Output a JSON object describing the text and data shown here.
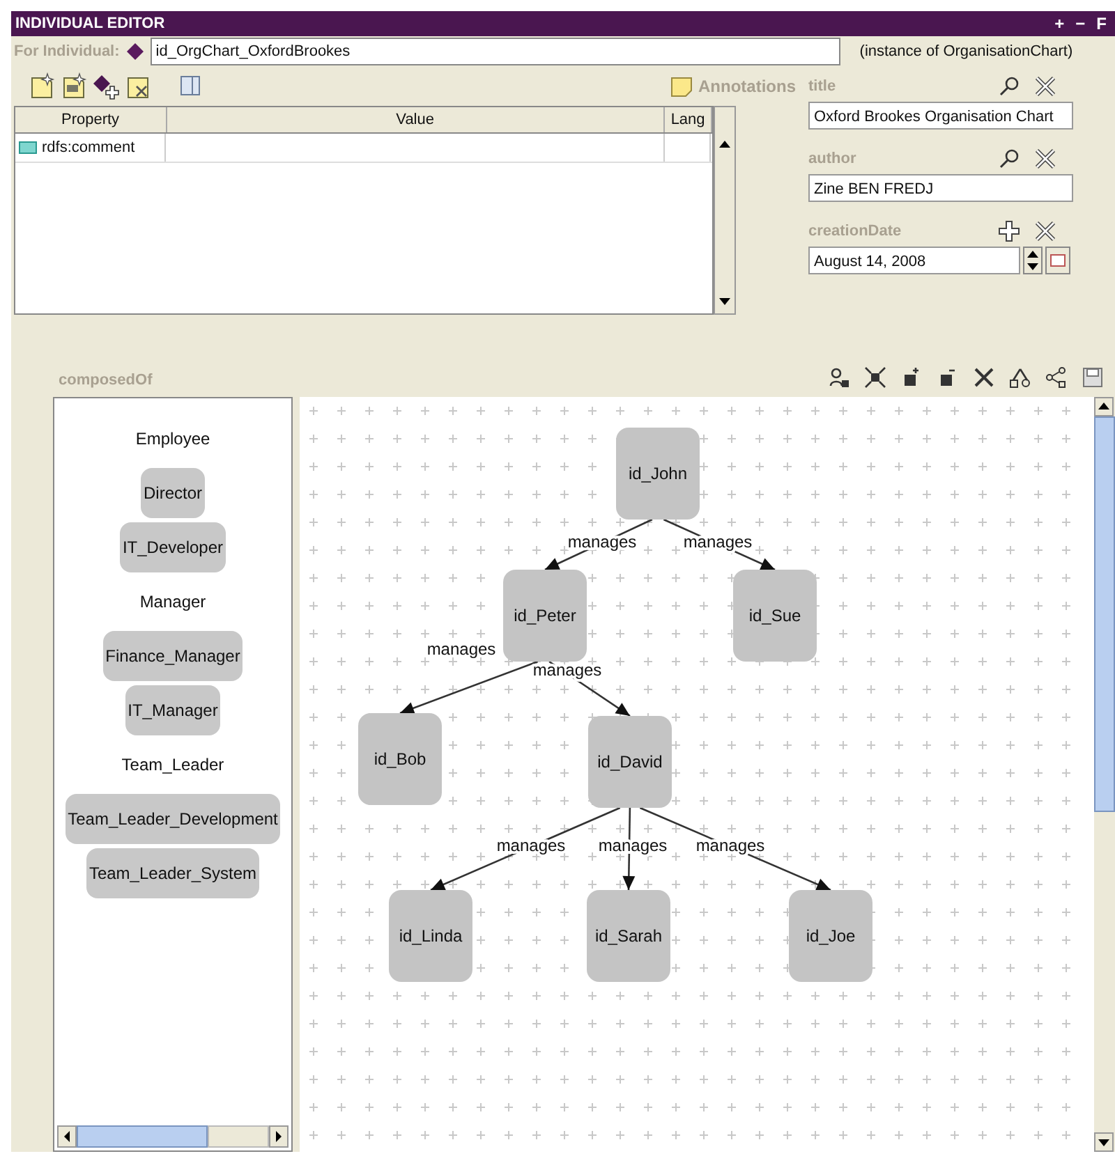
{
  "window": {
    "title": "INDIVIDUAL EDITOR",
    "controls": [
      "+",
      "−",
      "F"
    ]
  },
  "individual": {
    "label": "For Individual:",
    "value": "id_OrgChart_OxfordBrookes",
    "instance": "(instance of OrganisationChart)"
  },
  "annotations": {
    "label": "Annotations"
  },
  "table": {
    "columns": [
      "Property",
      "Value",
      "Lang"
    ],
    "rows": [
      {
        "property": "rdfs:comment"
      }
    ]
  },
  "fields": [
    {
      "kind": "text",
      "label": "title",
      "value": "Oxford Brookes Organisation Chart"
    },
    {
      "kind": "text",
      "label": "author",
      "value": "Zine BEN FREDJ"
    },
    {
      "kind": "date",
      "label": "creationDate",
      "value": "August 14, 2008"
    }
  ],
  "composed": {
    "label": "composedOf",
    "palette": [
      {
        "kind": "class",
        "label": "Employee"
      },
      {
        "kind": "node",
        "label": "Director"
      },
      {
        "kind": "node",
        "label": "IT_Developer"
      },
      {
        "kind": "class",
        "label": "Manager"
      },
      {
        "kind": "node",
        "label": "Finance_Manager"
      },
      {
        "kind": "node",
        "label": "IT_Manager"
      },
      {
        "kind": "class",
        "label": "Team_Leader"
      },
      {
        "kind": "node",
        "label": "Team_Leader_Development"
      },
      {
        "kind": "node",
        "label": "Team_Leader_System"
      }
    ],
    "nodes": [
      "id_John",
      "id_Peter",
      "id_Sue",
      "id_Bob",
      "id_David",
      "id_Linda",
      "id_Sarah",
      "id_Joe"
    ],
    "edges": [
      {
        "label": "manages"
      },
      {
        "label": "manages"
      },
      {
        "label": "manages"
      },
      {
        "label": "manages"
      },
      {
        "label": "manages"
      },
      {
        "label": "manages"
      },
      {
        "label": "manages"
      }
    ]
  }
}
